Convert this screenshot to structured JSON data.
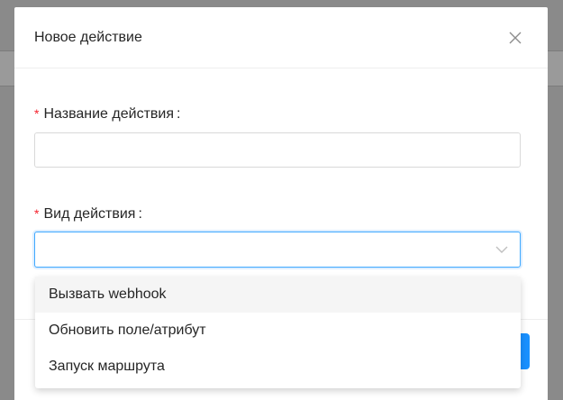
{
  "modal": {
    "title": "Новое действие",
    "close_icon": "close-icon"
  },
  "form": {
    "action_name": {
      "label": "Название действия",
      "required_mark": "*",
      "colon": ":",
      "value": "",
      "placeholder": ""
    },
    "action_type": {
      "label": "Вид действия",
      "required_mark": "*",
      "colon": ":",
      "selected": "",
      "arrow_icon": "chevron-down-icon"
    }
  },
  "dropdown": {
    "options": [
      {
        "label": "Вызвать webhook",
        "highlighted": true
      },
      {
        "label": "Обновить поле/атрибут",
        "highlighted": false
      },
      {
        "label": "Запуск маршрута",
        "highlighted": false
      }
    ]
  },
  "colors": {
    "accent": "#1890ff",
    "required": "#f5222d",
    "overlay": "#8c8c8c"
  }
}
